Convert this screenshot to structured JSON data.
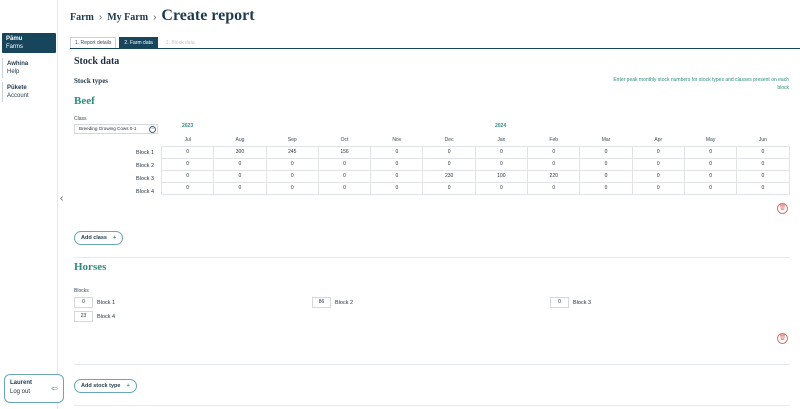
{
  "sidebar": {
    "items": [
      {
        "maori": "Pāmu",
        "label": "Farms"
      },
      {
        "maori": "Awhina",
        "label": "Help"
      },
      {
        "maori": "Pūkete",
        "label": "Account"
      }
    ],
    "collapse_icon": "chevron-left-icon"
  },
  "user": {
    "name": "Laurent",
    "logout": "Log out",
    "logout_icon": "logout-arrow-icon"
  },
  "breadcrumb": [
    "Farm",
    "My Farm"
  ],
  "page_title": "Create report",
  "tabs": [
    "1. Report details",
    "2. Farm data",
    "3. Block data"
  ],
  "stock_data_heading": "Stock data",
  "stock_types_heading": "Stock types",
  "instructions": "Enter peak monthly stock numbers for stock types and classes present on each block",
  "beef": {
    "title": "Beef",
    "class_label": "Class",
    "class_value": "Breeding Growing Cows 0-1",
    "years": [
      "2023",
      "2024"
    ],
    "months": [
      "Jul",
      "Aug",
      "Sep",
      "Oct",
      "Nov",
      "Dec",
      "Jan",
      "Feb",
      "Mar",
      "Apr",
      "May",
      "Jun"
    ],
    "rows": [
      {
        "block": "Block 1",
        "values": [
          "0",
          "300",
          "245",
          "156",
          "0",
          "0",
          "0",
          "0",
          "0",
          "0",
          "0",
          "0"
        ]
      },
      {
        "block": "Block 2",
        "values": [
          "0",
          "0",
          "0",
          "0",
          "0",
          "0",
          "0",
          "0",
          "0",
          "0",
          "0",
          "0"
        ]
      },
      {
        "block": "Block 3",
        "values": [
          "0",
          "0",
          "0",
          "0",
          "0",
          "230",
          "100",
          "220",
          "0",
          "0",
          "0",
          "0"
        ]
      },
      {
        "block": "Block 4",
        "values": [
          "0",
          "0",
          "0",
          "0",
          "0",
          "0",
          "0",
          "0",
          "0",
          "0",
          "0",
          "0"
        ]
      }
    ],
    "add_class": "Add class"
  },
  "horses": {
    "title": "Horses",
    "blocks_label": "Blocks",
    "blocks": [
      {
        "value": "0",
        "name": "Block 1"
      },
      {
        "value": "86",
        "name": "Block 2"
      },
      {
        "value": "0",
        "name": "Block 3"
      },
      {
        "value": "23",
        "name": "Block 4"
      }
    ]
  },
  "add_stock_type": "Add stock type",
  "colors": {
    "primary": "#17465c",
    "accent": "#2f8c7e",
    "danger": "#d9756c"
  }
}
